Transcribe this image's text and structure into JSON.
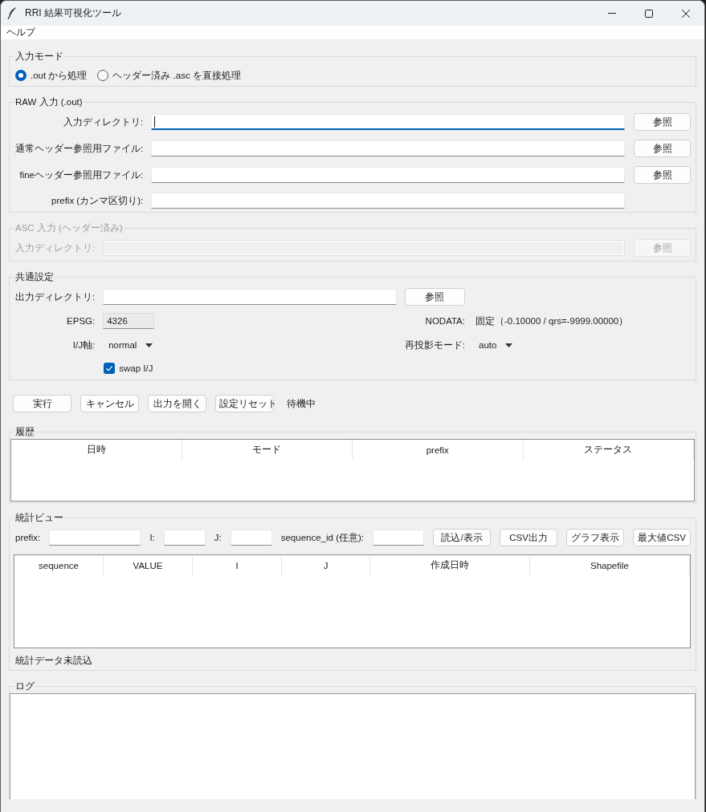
{
  "window": {
    "title": "RRI 結果可視化ツール"
  },
  "menu_bar": {
    "items": [
      "ヘルプ"
    ]
  },
  "input_mode": {
    "title": "入力モード",
    "options": [
      {
        "label": ".out から処理",
        "selected": true
      },
      {
        "label": "ヘッダー済み .asc を直接処理",
        "selected": false
      }
    ]
  },
  "raw_input": {
    "title": "RAW 入力 (.out)",
    "disabled": false,
    "rows": [
      {
        "label": "入力ディレクトリ:",
        "focused": true,
        "button": "参照"
      },
      {
        "label": "通常ヘッダー参照用ファイル:",
        "focused": false,
        "button": "参照"
      },
      {
        "label": "fineヘッダー参照用ファイル:",
        "focused": false,
        "button": "参照"
      },
      {
        "label": "prefix (カンマ区切り):",
        "focused": false
      }
    ]
  },
  "asc_input": {
    "title": "ASC 入力 (ヘッダー済み)",
    "disabled": true,
    "rows": [
      {
        "label": "入力ディレクトリ:",
        "focused": false,
        "button": "参照"
      }
    ]
  },
  "common_settings": {
    "title": "共通設定",
    "output_dir": {
      "label": "出力ディレクトリ:",
      "button": "参照"
    },
    "epsg": {
      "label": "EPSG:",
      "value": "4326",
      "readonly": true
    },
    "nodata": {
      "label": "NODATA:",
      "value": "固定（-0.10000 / qrs=-9999.00000）"
    },
    "ij_axis": {
      "label": "I/J軸:",
      "value": "normal"
    },
    "reprojection_mode": {
      "label": "再投影モード:",
      "value": "auto"
    },
    "swap_ij": {
      "label": "swap I/J",
      "checked": true
    }
  },
  "actions": {
    "buttons": [
      "実行",
      "キャンセル",
      "出力を開く",
      "設定リセット"
    ],
    "status": "待機中"
  },
  "history": {
    "title": "履歴",
    "table": {
      "columns": [
        "日時",
        "モード",
        "prefix",
        "ステータス"
      ]
    }
  },
  "stats_view": {
    "title": "統計ビュー",
    "filters": [
      {
        "label": "prefix:"
      },
      {
        "label": "I:"
      },
      {
        "label": "J:"
      },
      {
        "label": "sequence_id (任意):"
      }
    ],
    "buttons": [
      "読込/表示",
      "CSV出力",
      "グラフ表示",
      "最大値CSV"
    ],
    "table": {
      "columns": [
        "sequence",
        "VALUE",
        "I",
        "J",
        "作成日時",
        "Shapefile"
      ]
    },
    "status": "統計データ未読込"
  },
  "log": {
    "title": "ログ"
  }
}
